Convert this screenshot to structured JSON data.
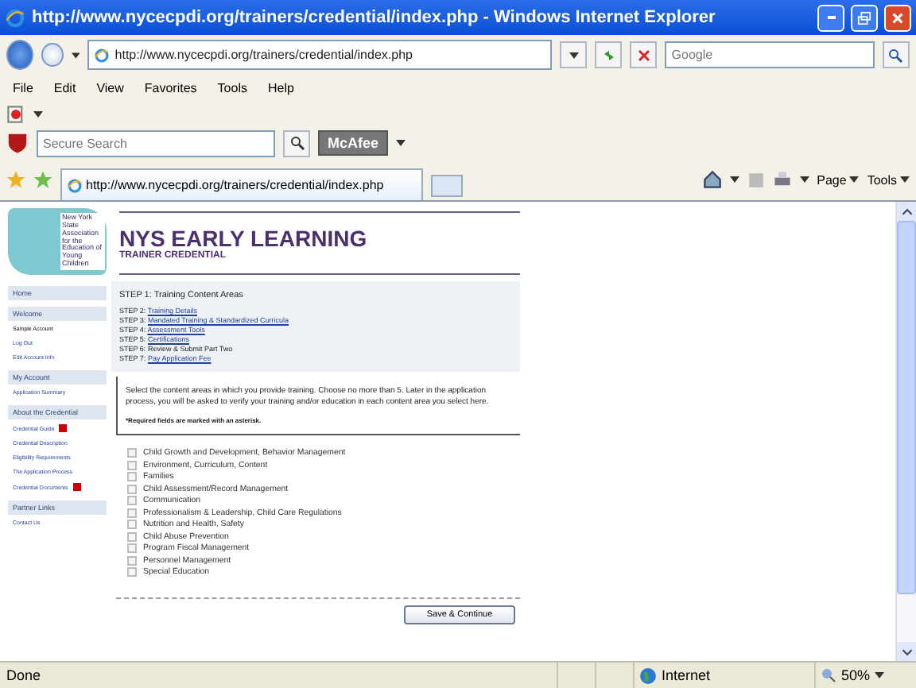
{
  "window": {
    "title": "http://www.nycecpdi.org/trainers/credential/index.php - Windows Internet Explorer"
  },
  "address_bar": {
    "url": "http://www.nycecpdi.org/trainers/credential/index.php"
  },
  "search": {
    "placeholder": "Google"
  },
  "menu": [
    "File",
    "Edit",
    "View",
    "Favorites",
    "Tools",
    "Help"
  ],
  "mcafee": {
    "placeholder": "Secure Search",
    "brand": "McAfee"
  },
  "tab": {
    "title": "http://www.nycecpdi.org/trainers/credential/index.php"
  },
  "command_bar": [
    "Page",
    "Tools"
  ],
  "page": {
    "logo_text": "New York State Association for the Education of Young Children",
    "title": "NYS EARLY LEARNING",
    "subtitle": "TRAINER CREDENTIAL",
    "sidebar": [
      {
        "kind": "header",
        "label": "Home"
      },
      {
        "kind": "header",
        "label": "Welcome"
      },
      {
        "kind": "text",
        "label": "Sample Account"
      },
      {
        "kind": "link",
        "label": "Log Out"
      },
      {
        "kind": "link",
        "label": "Edit Account Info"
      },
      {
        "kind": "header",
        "label": "My Account"
      },
      {
        "kind": "link",
        "label": "Application Summary"
      },
      {
        "kind": "header",
        "label": "About the Credential"
      },
      {
        "kind": "link",
        "label": "Credential Guide",
        "document": true
      },
      {
        "kind": "link",
        "label": "Credential Description"
      },
      {
        "kind": "link",
        "label": "Eligibility Requirements"
      },
      {
        "kind": "link",
        "label": "The Application Process"
      },
      {
        "kind": "link",
        "label": "Credential Documents",
        "document": true
      },
      {
        "kind": "header",
        "label": "Partner Links"
      },
      {
        "kind": "link",
        "label": "Contact Us"
      }
    ],
    "steps": [
      {
        "prefix": "STEP 1:",
        "label": "Training Content Areas",
        "current": true
      },
      {
        "prefix": "STEP 2:",
        "label": "Training Details",
        "current": false,
        "link": true
      },
      {
        "prefix": "STEP 3:",
        "label": "Mandated Training & Standardized Curricula",
        "current": false,
        "link": true
      },
      {
        "prefix": "STEP 4:",
        "label": "Assessment Tools",
        "current": false,
        "link": true
      },
      {
        "prefix": "STEP 5:",
        "label": "Certifications",
        "current": false,
        "link": true
      },
      {
        "prefix": "STEP 6:",
        "label": "Review & Submit Part Two",
        "current": false,
        "link": false
      },
      {
        "prefix": "STEP 7:",
        "label": "Pay Application Fee",
        "current": false,
        "link": true
      }
    ],
    "intro": "Select the content areas in which you provide training. Choose no more than 5. Later in the application process, you will be asked to verify your training and/or education in each content area you select here.",
    "required_note": "*Required fields are marked with an asterisk.",
    "content_areas": [
      {
        "label": "Child Growth and Development, Behavior Management",
        "checked": false
      },
      {
        "label": "Environment, Curriculum, Content",
        "checked": false
      },
      {
        "label": "Families",
        "checked": false
      },
      {
        "label": "Child Assessment/Record Management",
        "checked": false
      },
      {
        "label": "Communication",
        "checked": false
      },
      {
        "label": "Professionalism & Leadership, Child Care Regulations",
        "checked": false
      },
      {
        "label": "Nutrition and Health, Safety",
        "checked": false
      },
      {
        "label": "Child Abuse Prevention",
        "checked": false
      },
      {
        "label": "Program Fiscal Management",
        "checked": false
      },
      {
        "label": "Personnel Management",
        "checked": false
      },
      {
        "label": "Special Education",
        "checked": false
      }
    ],
    "save_button": "Save & Continue"
  },
  "status_bar": {
    "status": "Done",
    "zone": "Internet",
    "zoom": "50%"
  }
}
